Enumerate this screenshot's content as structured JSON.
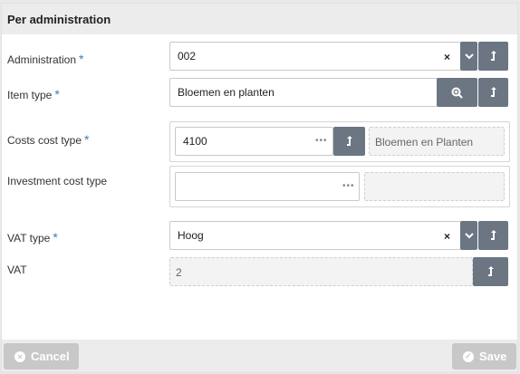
{
  "header": {
    "title": "Per administration"
  },
  "fields": {
    "administration": {
      "label": "Administration",
      "required_mark": "*",
      "value": "002",
      "clear": "×"
    },
    "item_type": {
      "label": "Item type",
      "required_mark": "*",
      "value": "Bloemen en planten"
    },
    "costs_cost_type": {
      "label": "Costs cost type",
      "required_mark": "*",
      "value": "4100",
      "description": "Bloemen en Planten",
      "dots": "•••"
    },
    "investment_cost_type": {
      "label": "Investment cost type",
      "value": "",
      "description": "",
      "dots": "•••"
    },
    "vat_type": {
      "label": "VAT type",
      "required_mark": "*",
      "value": "Hoog",
      "clear": "×"
    },
    "vat": {
      "label": "VAT",
      "value": "2"
    }
  },
  "footer": {
    "cancel_label": "Cancel",
    "save_label": "Save",
    "cancel_icon": "×",
    "save_icon": "✓"
  }
}
